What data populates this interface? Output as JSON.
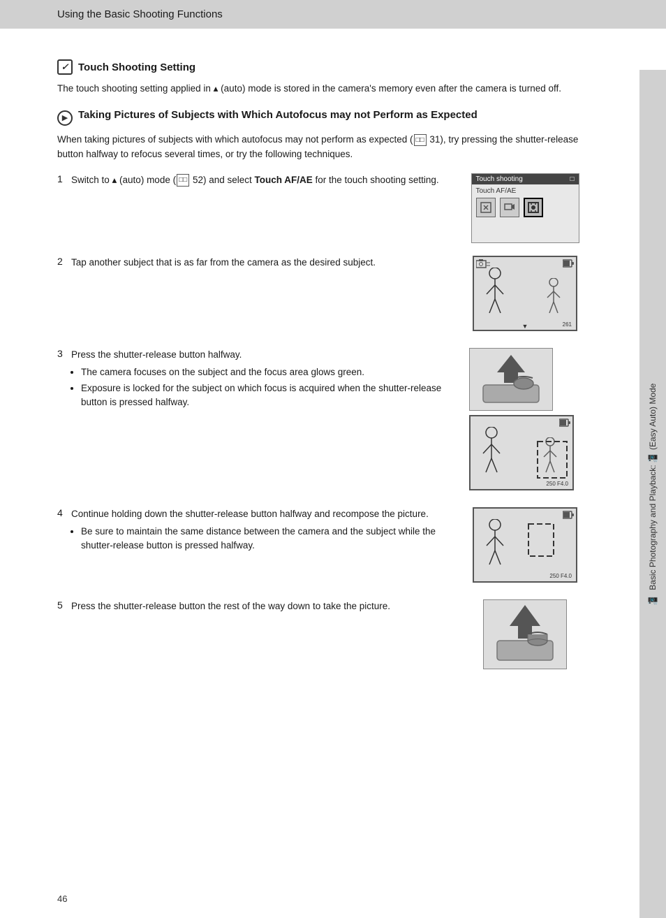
{
  "header": {
    "title": "Using the Basic Shooting Functions"
  },
  "page_number": "46",
  "sidebar": {
    "text": "Basic Photography and Playback:",
    "icon_label": "(Easy Auto) Mode"
  },
  "section1": {
    "icon_type": "note",
    "icon_char": "✎",
    "title": "Touch Shooting Setting",
    "body": "The touch shooting setting applied in  (auto) mode is stored in the camera's memory even after the camera is turned off."
  },
  "section2": {
    "icon_type": "camera",
    "title": "Taking Pictures of Subjects with Which Autofocus may not Perform as Expected",
    "intro": "When taking pictures of subjects with which autofocus may not perform as expected ( 31), try pressing the shutter-release button halfway to refocus several times, or try the following techniques.",
    "steps": [
      {
        "number": "1",
        "text_prefix": "Switch to",
        "text_mode": " (auto) mode (",
        "text_ref": "52",
        "text_suffix": ") and select ",
        "text_bold": "Touch AF/AE",
        "text_end": " for the touch shooting setting.",
        "has_image": "touch-ui"
      },
      {
        "number": "2",
        "text": "Tap another subject that is as far from the camera as the desired subject.",
        "has_image": "viewfinder1"
      },
      {
        "number": "3",
        "text": "Press the shutter-release button halfway.",
        "bullets": [
          "The camera focuses on the subject and the focus area glows green.",
          "Exposure is locked for the subject on which focus is acquired when the shutter-release button is pressed halfway."
        ],
        "has_image": "shutter-pair"
      },
      {
        "number": "4",
        "text": "Continue holding down the shutter-release button halfway and recompose the picture.",
        "bullets": [
          "Be sure to maintain the same distance between the camera and the subject while the shutter-release button is pressed halfway."
        ],
        "has_image": "viewfinder3"
      },
      {
        "number": "5",
        "text": "Press the shutter-release button the rest of the way down to take the picture.",
        "has_image": "shutter2"
      }
    ]
  },
  "touch_ui": {
    "header_label": "Touch shooting",
    "body_label": "Touch AF/AE",
    "icons": [
      "☐",
      "⬚",
      "⊠"
    ]
  }
}
